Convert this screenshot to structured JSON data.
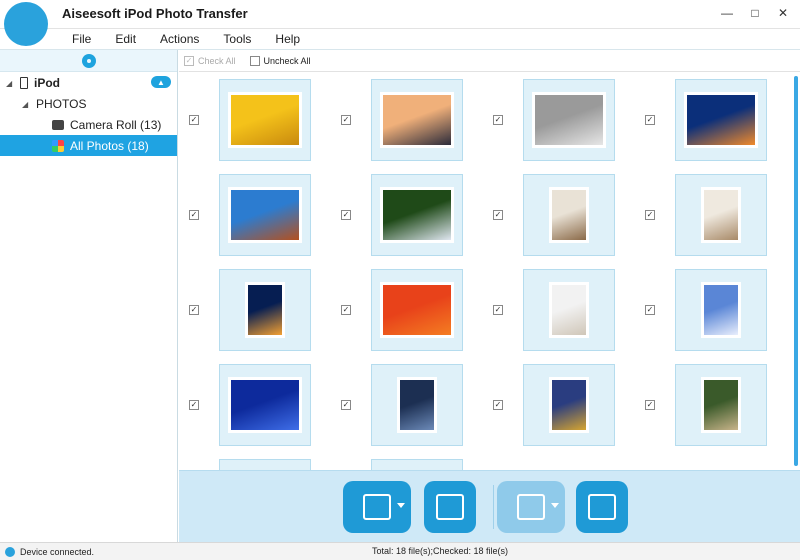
{
  "window": {
    "title": "Aiseesoft iPod Photo Transfer",
    "controls": [
      "minimize-icon",
      "maximize-icon",
      "close-icon"
    ]
  },
  "menu": [
    "File",
    "Edit",
    "Actions",
    "Tools",
    "Help"
  ],
  "sidebar": {
    "device": "iPod",
    "section": "PHOTOS",
    "items": [
      {
        "label": "Camera Roll (13)",
        "icon": "camera-icon",
        "selected": false
      },
      {
        "label": "All Photos (18)",
        "icon": "photos-icon",
        "selected": true
      }
    ]
  },
  "toolbar": {
    "check_all": "Check All",
    "uncheck_all": "Uncheck All"
  },
  "photos": [
    {
      "name": "yellow-tulips",
      "colors": [
        "#f4c21a",
        "#c98a0e"
      ]
    },
    {
      "name": "lighthouse",
      "colors": [
        "#f0b07a",
        "#2b2b3a"
      ]
    },
    {
      "name": "koala",
      "colors": [
        "#9a9a9a",
        "#e6e6e6"
      ]
    },
    {
      "name": "jellyfish",
      "colors": [
        "#0b2f7a",
        "#f08a2b"
      ]
    },
    {
      "name": "desert",
      "colors": [
        "#2c7cd0",
        "#b4501e"
      ]
    },
    {
      "name": "hydrangea",
      "colors": [
        "#1f4a18",
        "#dfe6f0"
      ]
    },
    {
      "name": "interior",
      "colors": [
        "#e9e2d6",
        "#8b6a48"
      ]
    },
    {
      "name": "interior-2",
      "colors": [
        "#efe9df",
        "#a88a68"
      ]
    },
    {
      "name": "jellyfish-2",
      "colors": [
        "#061e52",
        "#f2a032"
      ]
    },
    {
      "name": "orange-flower",
      "colors": [
        "#e8421a",
        "#f47d22"
      ]
    },
    {
      "name": "white-dog",
      "colors": [
        "#f2f2f2",
        "#cfc6b8"
      ]
    },
    {
      "name": "sky-clouds",
      "colors": [
        "#5a86d6",
        "#e8eefc"
      ]
    },
    {
      "name": "blue-rose",
      "colors": [
        "#0d2a9c",
        "#3f6ee8"
      ]
    },
    {
      "name": "lake-night",
      "colors": [
        "#1c2f52",
        "#6c8ab8"
      ]
    },
    {
      "name": "gold-leaves",
      "colors": [
        "#2a3d80",
        "#d6a530"
      ]
    },
    {
      "name": "garden-path",
      "colors": [
        "#3a5a2a",
        "#c8b48a"
      ]
    },
    {
      "name": "partial-1",
      "colors": [
        "#8d9aa6",
        "#c9c2b6"
      ]
    },
    {
      "name": "partial-2",
      "colors": [
        "#6b7d52",
        "#c7d1b0"
      ]
    }
  ],
  "status": {
    "left": "Device connected.",
    "center": "Total: 18 file(s);Checked: 18 file(s)"
  },
  "actions": [
    "add-video-icon",
    "remove-video-icon",
    "export-device-icon",
    "export-pc-icon"
  ]
}
